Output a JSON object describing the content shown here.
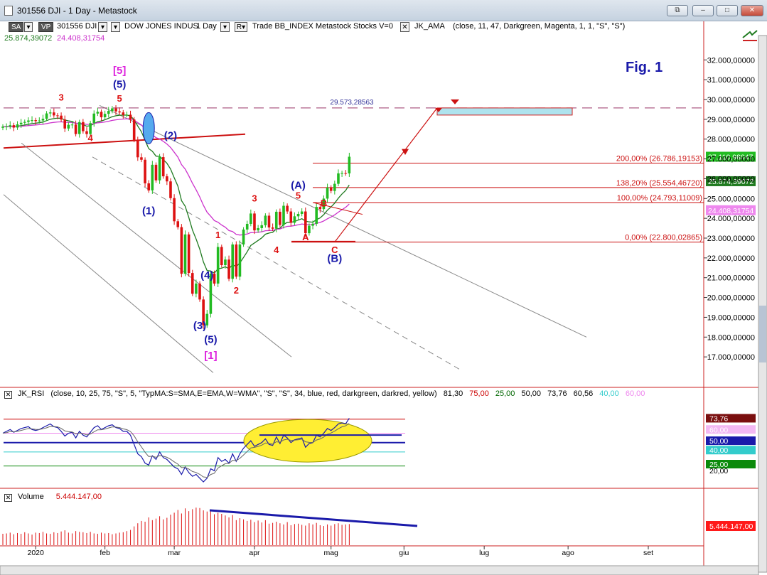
{
  "window": {
    "title": "301556 DJI - 1 Day - Metastock",
    "buttons": {
      "restore": "⧉",
      "minimize": "–",
      "maximize": "□",
      "close": "✕"
    }
  },
  "toolbar": {
    "btn_sa": "SA",
    "btn_vp": "VP",
    "symbol": "301556 DJI",
    "security_name": "DOW JONES INDUS",
    "period": "1 Day",
    "r_label": "R",
    "trade_info": "Trade  BB_INDEX  Metastock  Stocks  V=0",
    "ama_label": "JK_AMA",
    "ama_params": "(close,  11,  47,  Darkgreen,  Magenta,  1,  1,  \"S\",  \"S\")",
    "ama_value_1": "25.874,39072",
    "ama_value_2": "24.408,31754",
    "checkbox_mark": "✕"
  },
  "colors": {
    "up_candle": "#22bb22",
    "down_candle": "#dd1111",
    "ama_fast": "#1f7a1f",
    "ama_slow": "#cc33cc",
    "wave_blue": "#1a1aaa",
    "wave_red": "#dd1111",
    "wave_magenta": "#dd22dd",
    "axis_line": "#cc2222"
  },
  "chart_data": [
    {
      "type": "candlestick",
      "title": "Fig. 1",
      "ylim": [
        16000,
        32800
      ],
      "y_ticks": [
        "32.000,00000",
        "31.000,00000",
        "30.000,00000",
        "29.000,00000",
        "28.000,00000",
        "27.000,00000",
        "26.000,00000",
        "25.000,00000",
        "24.000,00000",
        "23.000,00000",
        "22.000,00000",
        "21.000,00000",
        "20.000,00000",
        "19.000,00000",
        "18.000,00000",
        "17.000,00000"
      ],
      "y_tick_values": [
        32000,
        31000,
        30000,
        29000,
        28000,
        27000,
        26000,
        25000,
        24000,
        23000,
        22000,
        21000,
        20000,
        19000,
        18000,
        17000
      ],
      "x_ticks": [
        {
          "label": "2020",
          "bar": 9
        },
        {
          "label": "feb",
          "bar": 28
        },
        {
          "label": "mar",
          "bar": 47
        },
        {
          "label": "apr",
          "bar": 69
        },
        {
          "label": "mag",
          "bar": 90
        },
        {
          "label": "giu",
          "bar": 110
        },
        {
          "label": "lug",
          "bar": 132
        },
        {
          "label": "ago",
          "bar": 155
        },
        {
          "label": "set",
          "bar": 177
        }
      ],
      "bar_count": 215,
      "close": [
        28630,
        28634,
        28703,
        28583,
        28745,
        28823,
        28868,
        28940,
        28957,
        28907,
        28939,
        29030,
        29297,
        29348,
        29196,
        29186,
        28990,
        28535,
        28722,
        28734,
        28256,
        28859,
        28399,
        28256,
        28807,
        29290,
        29379,
        29102,
        29276,
        29423,
        29551,
        29398,
        29348,
        29219,
        29232,
        28993,
        27960,
        27081,
        26957,
        25766,
        25409,
        26703,
        25917,
        27090,
        26121,
        25864,
        25018,
        23851,
        23553,
        21200,
        23185,
        21237,
        20189,
        20704,
        19899,
        18592,
        19174,
        21200,
        20704,
        22552,
        21636,
        21917,
        20943,
        22679,
        21053,
        22679,
        23433,
        23719,
        24242,
        23390,
        23504,
        23650,
        24133,
        23537,
        23475,
        24331,
        23664,
        24633,
        24345,
        23775,
        24101,
        24221,
        24345,
        23247,
        23625,
        23723,
        24575,
        24465,
        24995,
        25548,
        25383,
        25742,
        26269,
        26281,
        26269,
        27110
      ],
      "ama_fast_label": "25.874,39072",
      "ama_slow_label": "24.408,31754",
      "last_price_label": "27.110,98047",
      "top_level": {
        "value": 29573.28563,
        "label": "29.573,28563"
      },
      "fib_levels": [
        {
          "label": "200,00% (26.786,19153)",
          "value": 26786.19153
        },
        {
          "label": "138,20% (25.554,46720)",
          "value": 25554.4672
        },
        {
          "label": "100,00% (24.793,11009)",
          "value": 24793.11009
        },
        {
          "label": "0,00% (22.800,02865)",
          "value": 22800.02865
        }
      ],
      "wave_labels": [
        {
          "text": "[5]",
          "bar": 32,
          "value": 31300,
          "color": "magenta"
        },
        {
          "text": "(5)",
          "bar": 32,
          "value": 30600,
          "color": "blue"
        },
        {
          "text": "5",
          "bar": 32,
          "value": 29900,
          "color": "red"
        },
        {
          "text": "3",
          "bar": 16,
          "value": 29950,
          "color": "red"
        },
        {
          "text": "4",
          "bar": 24,
          "value": 27900,
          "color": "red"
        },
        {
          "text": "(2)",
          "bar": 46,
          "value": 28000,
          "color": "blue"
        },
        {
          "text": "(1)",
          "bar": 40,
          "value": 24200,
          "color": "blue"
        },
        {
          "text": "3",
          "bar": 69,
          "value": 24850,
          "color": "red"
        },
        {
          "text": "1",
          "bar": 59,
          "value": 23000,
          "color": "red"
        },
        {
          "text": "(4)",
          "bar": 56,
          "value": 20950,
          "color": "blue"
        },
        {
          "text": "2",
          "bar": 64,
          "value": 20200,
          "color": "red"
        },
        {
          "text": "(3)",
          "bar": 54,
          "value": 18400,
          "color": "blue"
        },
        {
          "text": "(5)",
          "bar": 57,
          "value": 17700,
          "color": "blue"
        },
        {
          "text": "[1]",
          "bar": 57,
          "value": 16900,
          "color": "magenta"
        },
        {
          "text": "(A)",
          "bar": 81,
          "value": 25500,
          "color": "blue"
        },
        {
          "text": "5",
          "bar": 81,
          "value": 25000,
          "color": "red"
        },
        {
          "text": "B",
          "bar": 88,
          "value": 24600,
          "color": "red"
        },
        {
          "text": "A",
          "bar": 83,
          "value": 22900,
          "color": "red"
        },
        {
          "text": "4",
          "bar": 75,
          "value": 22250,
          "color": "red"
        },
        {
          "text": "C",
          "bar": 91,
          "value": 22250,
          "color": "red"
        },
        {
          "text": "(B)",
          "bar": 91,
          "value": 21800,
          "color": "blue"
        }
      ]
    },
    {
      "type": "line",
      "name": "JK_RSI",
      "params": "(close,  10,  25,  75,  \"S\",  5,  \"TypMA:S=SMA,E=EMA,W=WMA\",  \"S\",  \"S\",  34,  blue,  red,  darkgreen,  darkred,  yellow)",
      "header_values": [
        {
          "text": "81,30",
          "color": "#000000"
        },
        {
          "text": "75,00",
          "color": "#cc0000"
        },
        {
          "text": "25,00",
          "color": "#006600"
        },
        {
          "text": "50,00",
          "color": "#000000"
        },
        {
          "text": "73,76",
          "color": "#000000"
        },
        {
          "text": "60,56",
          "color": "#000000"
        },
        {
          "text": "40,00",
          "color": "#33cccc"
        },
        {
          "text": "60,00",
          "color": "#ee88ee"
        }
      ],
      "ylim": [
        5,
        90
      ],
      "right_tags": [
        {
          "label": "73,76",
          "value": 76,
          "bg": "#7a0f0f",
          "fg": "#ffffff"
        },
        {
          "label": "60,00",
          "value": 64,
          "bg": "#f3b8f3",
          "fg": "#ffffff"
        },
        {
          "label": "50,00",
          "value": 52,
          "bg": "#1a1aaa",
          "fg": "#ffffff"
        },
        {
          "label": "40,00",
          "value": 42,
          "bg": "#33cccc",
          "fg": "#ffffff"
        },
        {
          "label": "25,00",
          "value": 27,
          "bg": "#0b8a0b",
          "fg": "#ffffff"
        },
        {
          "label": "20,00",
          "value": 20,
          "bg": "",
          "fg": "#000000"
        }
      ],
      "levels": [
        {
          "value": 75,
          "color": "#cc0000"
        },
        {
          "value": 50,
          "color": "#1a1aaa"
        },
        {
          "value": 60,
          "color": "#ee88ee"
        },
        {
          "value": 40,
          "color": "#33cccc"
        },
        {
          "value": 25,
          "color": "#0b8a0b"
        }
      ],
      "rsi": [
        60,
        62,
        64,
        61,
        63,
        65,
        66,
        67,
        64,
        63,
        64,
        66,
        68,
        70,
        67,
        66,
        62,
        57,
        60,
        61,
        55,
        62,
        58,
        56,
        61,
        66,
        68,
        64,
        66,
        68,
        69,
        66,
        65,
        62,
        62,
        58,
        48,
        38,
        35,
        28,
        26,
        36,
        32,
        40,
        34,
        32,
        28,
        24,
        22,
        16,
        24,
        18,
        14,
        16,
        12,
        8,
        12,
        22,
        20,
        34,
        30,
        32,
        28,
        38,
        30,
        38,
        44,
        48,
        52,
        46,
        48,
        50,
        54,
        48,
        47,
        56,
        49,
        58,
        55,
        50,
        53,
        54,
        55,
        45,
        49,
        50,
        58,
        56,
        60,
        65,
        63,
        66,
        70,
        71,
        70,
        76
      ]
    },
    {
      "type": "bar",
      "name": "Volume",
      "value_label": "5.444.147,00",
      "volume": [
        2.9,
        3.0,
        3.2,
        2.8,
        3.1,
        2.9,
        3.3,
        3.0,
        2.7,
        3.2,
        3.1,
        3.4,
        3.0,
        2.9,
        3.3,
        3.1,
        3.5,
        3.8,
        3.2,
        3.0,
        3.6,
        3.4,
        3.3,
        3.1,
        3.4,
        3.0,
        2.9,
        3.2,
        3.0,
        3.1,
        2.8,
        3.0,
        3.2,
        3.3,
        3.6,
        3.9,
        4.8,
        5.6,
        6.2,
        6.0,
        7.1,
        6.4,
        6.8,
        7.4,
        6.6,
        7.0,
        7.8,
        8.3,
        9.0,
        8.1,
        9.4,
        8.7,
        9.2,
        9.6,
        9.5,
        8.9,
        8.6,
        8.8,
        7.9,
        8.3,
        8.0,
        7.6,
        7.1,
        7.7,
        6.4,
        6.9,
        6.6,
        6.2,
        6.5,
        5.9,
        6.3,
        5.8,
        6.4,
        5.5,
        5.7,
        6.0,
        5.6,
        5.3,
        5.9,
        5.1,
        5.4,
        5.5,
        5.2,
        5.0,
        5.6,
        5.3,
        5.7,
        5.1,
        4.9,
        5.3,
        5.0,
        5.4,
        5.6,
        5.2,
        5.3,
        5.4
      ]
    }
  ]
}
